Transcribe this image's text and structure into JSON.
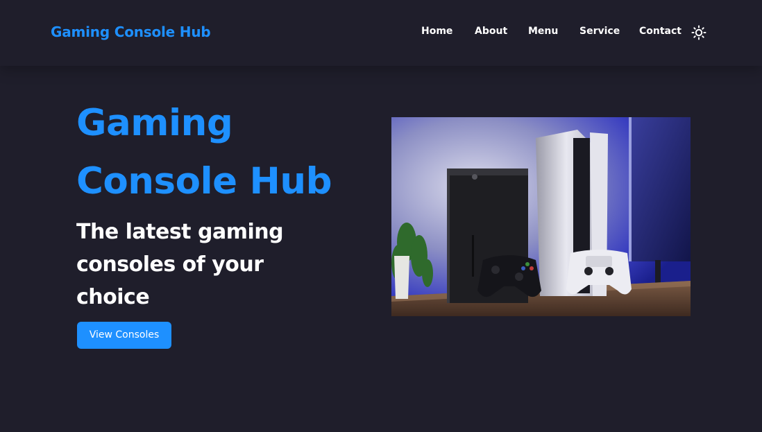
{
  "header": {
    "brand": "Gaming Console Hub",
    "nav": [
      {
        "label": "Home"
      },
      {
        "label": "About"
      },
      {
        "label": "Menu"
      },
      {
        "label": "Service"
      },
      {
        "label": "Contact"
      }
    ],
    "theme_icon": "sun-icon"
  },
  "hero": {
    "title": "Gaming Console Hub",
    "subtitle": "The latest gaming consoles of your choice",
    "cta_label": "View Consoles",
    "image": "gaming-consoles-photo"
  },
  "colors": {
    "background": "#1f1e2b",
    "accent": "#1e90ff",
    "text": "#ffffff"
  }
}
